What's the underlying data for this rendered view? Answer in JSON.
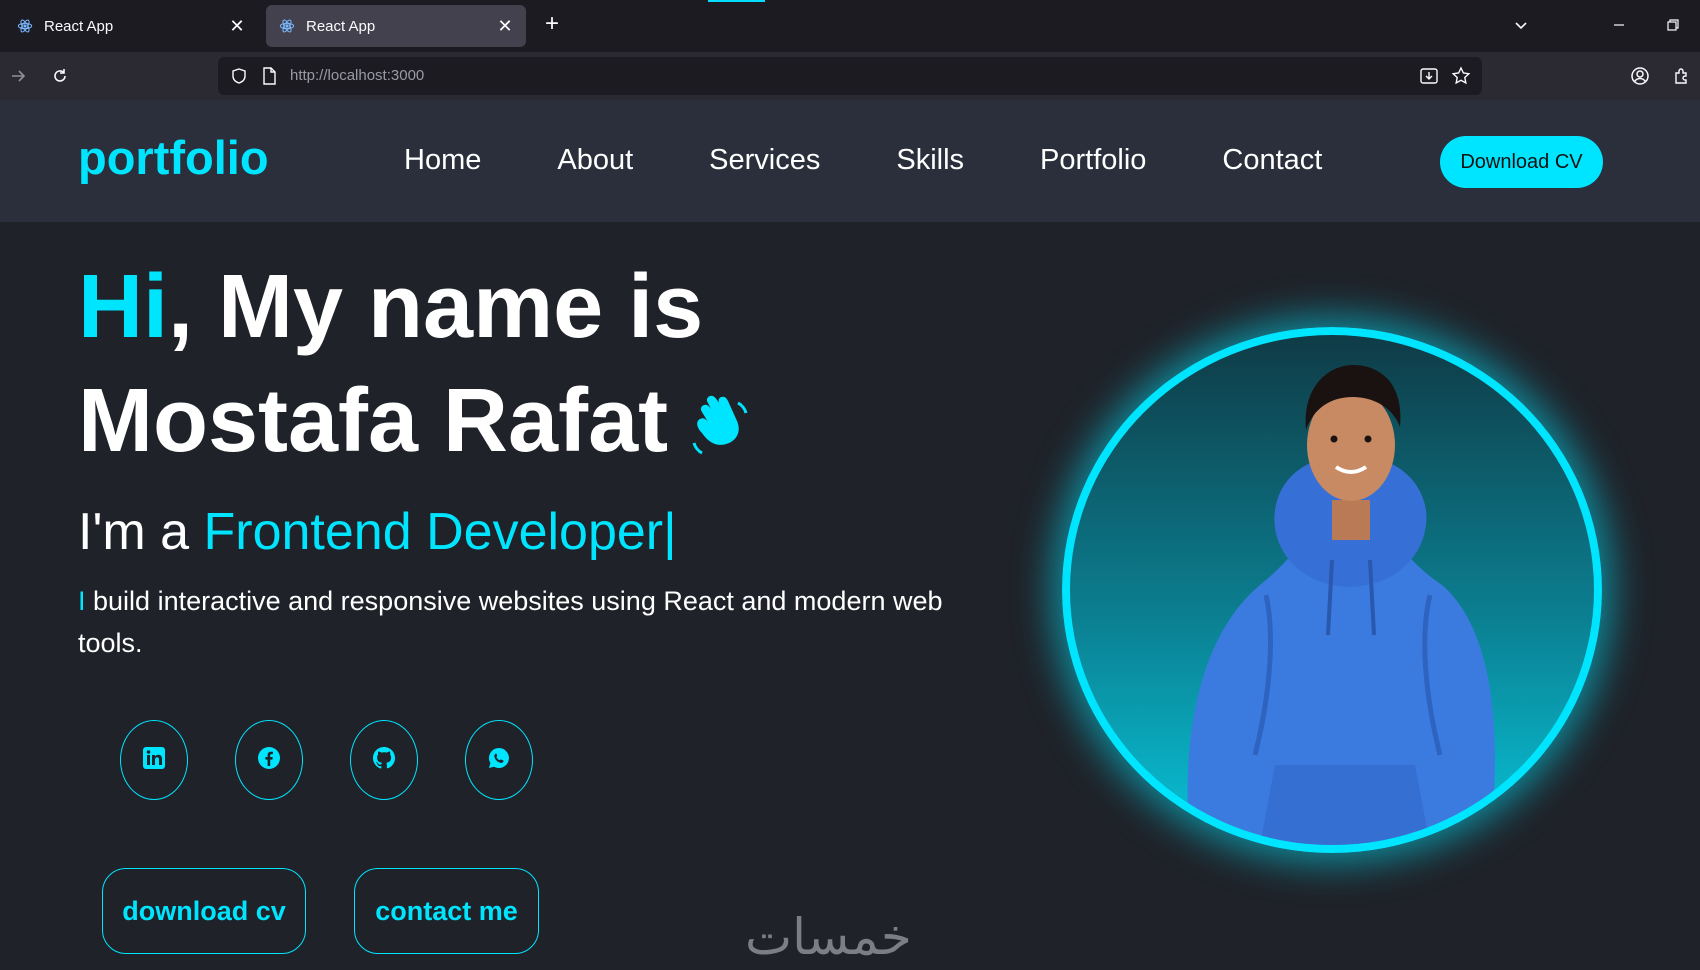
{
  "browser": {
    "tabs": [
      {
        "title": "React App",
        "active": false
      },
      {
        "title": "React App",
        "active": true
      }
    ],
    "url_scheme_host": "http://localhost",
    "url_port": ":3000"
  },
  "site": {
    "logo": "portfolio",
    "nav": [
      "Home",
      "About",
      "Services",
      "Skills",
      "Portfolio",
      "Contact"
    ],
    "download_cv_button": "Download CV"
  },
  "hero": {
    "greeting_accent": "Hi",
    "greeting_rest": ", My name is",
    "name": "Mostafa Rafat",
    "role_prefix": "I'm a ",
    "role": "Frontend Developer|",
    "description_bar": "I",
    "description": " build interactive and responsive websites using React and modern web tools.",
    "socials": [
      "linkedin-icon",
      "facebook-icon",
      "github-icon",
      "whatsapp-icon"
    ],
    "buttons": {
      "download": "download cv",
      "contact": "contact me"
    }
  },
  "watermark": "خمسات",
  "colors": {
    "accent": "#00e5ff",
    "background": "#1f2229",
    "header": "#2a2f3b"
  }
}
